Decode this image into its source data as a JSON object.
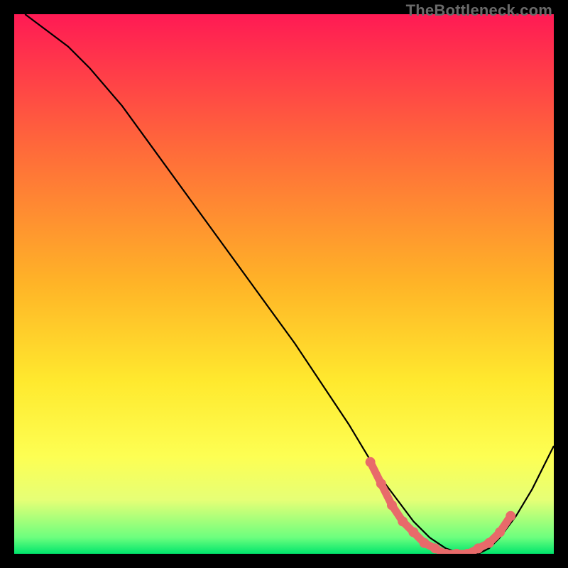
{
  "watermark": "TheBottleneck.com",
  "chart_data": {
    "type": "line",
    "title": "",
    "xlabel": "",
    "ylabel": "",
    "xlim": [
      0,
      100
    ],
    "ylim": [
      0,
      100
    ],
    "grid": false,
    "gradient_stops": [
      {
        "pct": 0,
        "color": "#ff1a54"
      },
      {
        "pct": 25,
        "color": "#ff6a3a"
      },
      {
        "pct": 50,
        "color": "#ffb427"
      },
      {
        "pct": 68,
        "color": "#ffe92e"
      },
      {
        "pct": 82,
        "color": "#fdff53"
      },
      {
        "pct": 90,
        "color": "#e6ff76"
      },
      {
        "pct": 97,
        "color": "#6cff7e"
      },
      {
        "pct": 100,
        "color": "#00e56c"
      }
    ],
    "series": [
      {
        "name": "bottleneck-curve",
        "color": "#000000",
        "x": [
          2,
          6,
          10,
          14,
          20,
          28,
          36,
          44,
          52,
          58,
          62,
          65,
          68,
          71,
          74,
          77,
          80,
          83,
          86,
          88,
          90,
          93,
          96,
          100
        ],
        "y": [
          100,
          97,
          94,
          90,
          83,
          72,
          61,
          50,
          39,
          30,
          24,
          19,
          14,
          10,
          6,
          3,
          1,
          0,
          0,
          1,
          3,
          7,
          12,
          20
        ]
      }
    ],
    "highlight": {
      "name": "optimal-range",
      "color": "#e86a6a",
      "x": [
        66,
        68,
        70,
        72,
        74,
        76,
        78,
        80,
        82,
        84,
        86,
        88,
        90,
        92
      ],
      "y": [
        17,
        13,
        9,
        6,
        4,
        2,
        1,
        0,
        0,
        0,
        1,
        2,
        4,
        7
      ]
    }
  }
}
